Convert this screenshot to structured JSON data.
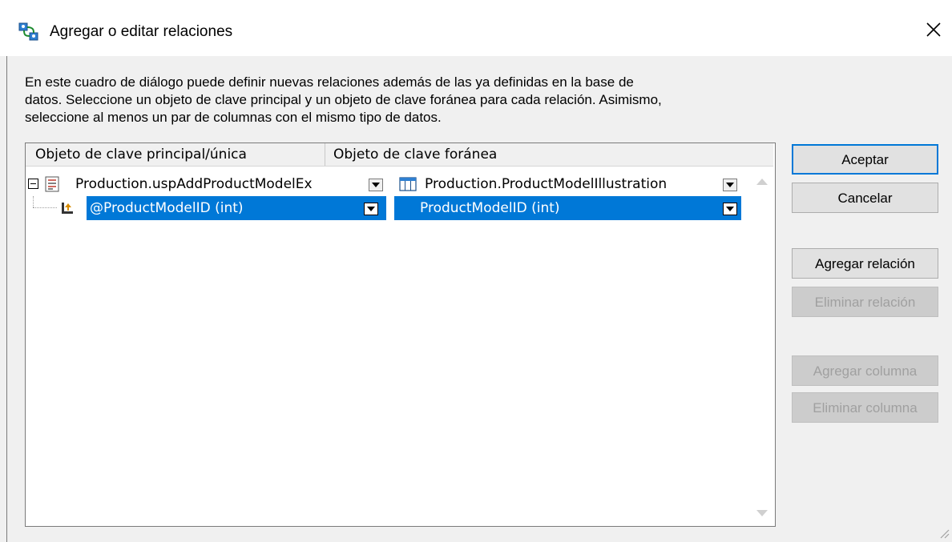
{
  "window": {
    "title": "Agregar o editar relaciones",
    "icon": "relations-icon",
    "close_icon": "close-icon"
  },
  "description": [
    "En este cuadro de diálogo puede definir nuevas relaciones además de las ya definidas en la base de",
    "datos. Seleccione un objeto de clave principal y un objeto de clave foránea para cada relación. Asimismo,",
    "seleccione al menos un par de columnas con el mismo tipo de datos."
  ],
  "grid": {
    "columns": [
      "Objeto de clave principal/única",
      "Objeto de clave foránea"
    ],
    "relation_row": {
      "primary_object": "Production.uspAddProductModelEx",
      "foreign_object": "Production.ProductModelIllustration"
    },
    "column_row": {
      "primary_column": "@ProductModelID (int)",
      "foreign_column": "ProductModelID (int)"
    }
  },
  "buttons": {
    "ok": "Aceptar",
    "cancel": "Cancelar",
    "add_relation": "Agregar relación",
    "remove_relation": "Eliminar relación",
    "add_column": "Agregar columna",
    "remove_column": "Eliminar columna"
  },
  "colors": {
    "selection": "#0078d7",
    "default_button_border": "#0078d7"
  }
}
